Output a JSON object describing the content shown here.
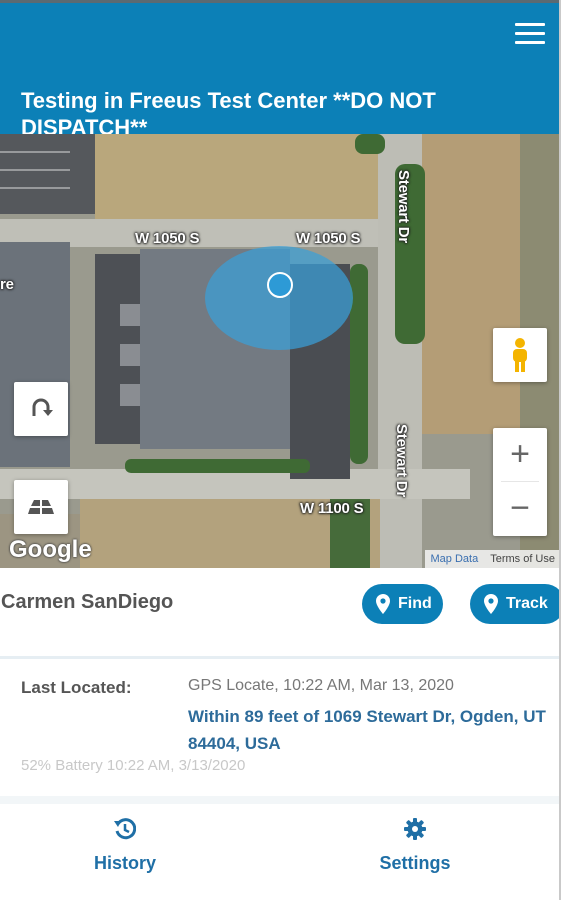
{
  "header": {
    "title": "Testing in Freeus Test Center **DO NOT DISPATCH**",
    "accent_color": "#0c80b7",
    "menu_icon": "hamburger-menu-icon"
  },
  "map": {
    "road_labels": [
      "W 1050 S",
      "W 1050 S",
      "Stewart Dr",
      "Stewart Dr",
      "W 1100 S",
      "re"
    ],
    "google_logo": "Google",
    "map_data_link": "Map Data",
    "terms_link": "Terms of Use",
    "zoom_in": "+",
    "zoom_out": "−"
  },
  "person": {
    "name": "Carmen SanDiego",
    "find_label": "Find",
    "track_label": "Track"
  },
  "location": {
    "label": "Last Located:",
    "source": "GPS Locate, 10:22 AM, Mar 13, 2020",
    "address": "Within 89 feet of 1069 Stewart Dr, Ogden, UT 84404, USA",
    "battery": "52% Battery 10:22 AM, 3/13/2020"
  },
  "tabs": {
    "history_label": "History",
    "settings_label": "Settings"
  }
}
